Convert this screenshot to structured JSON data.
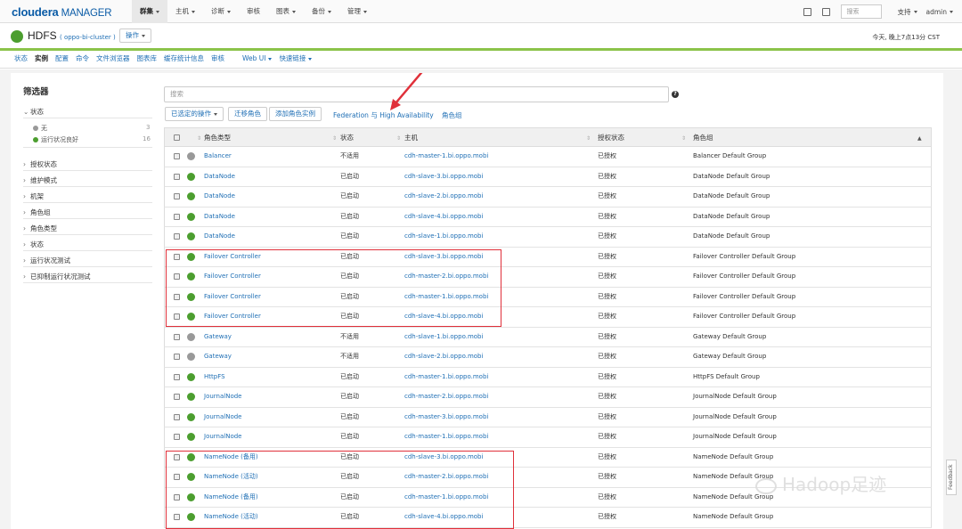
{
  "topbar": {
    "logo_brand": "cloudera",
    "logo_product": "MANAGER",
    "nav": [
      {
        "label": "群集",
        "active": true,
        "dropdown": true
      },
      {
        "label": "主机",
        "active": false,
        "dropdown": true
      },
      {
        "label": "诊断",
        "active": false,
        "dropdown": true
      },
      {
        "label": "审核",
        "active": false,
        "dropdown": false
      },
      {
        "label": "图表",
        "active": false,
        "dropdown": true
      },
      {
        "label": "备份",
        "active": false,
        "dropdown": true
      },
      {
        "label": "管理",
        "active": false,
        "dropdown": true
      }
    ],
    "search_placeholder": "搜索",
    "support_label": "支持",
    "user_label": "admin"
  },
  "service_header": {
    "title": "HDFS",
    "cluster": "( oppo-bi-cluster )",
    "actions_label": "操作",
    "time": "今天, 晚上7点13分 CST",
    "status_color": "#4c9e2f"
  },
  "subnav": [
    {
      "label": "状态",
      "active": false
    },
    {
      "label": "实例",
      "active": true
    },
    {
      "label": "配置",
      "active": false
    },
    {
      "label": "命令",
      "active": false
    },
    {
      "label": "文件浏览器",
      "active": false
    },
    {
      "label": "图表库",
      "active": false
    },
    {
      "label": "缓存统计信息",
      "active": false
    },
    {
      "label": "审核",
      "active": false
    },
    {
      "label": "Web UI",
      "active": false,
      "dropdown": true
    },
    {
      "label": "快速链接",
      "active": false,
      "dropdown": true
    }
  ],
  "filters": {
    "title": "筛选器",
    "status_section": "状态",
    "status_items": [
      {
        "label": "无",
        "count": "3",
        "color": "#999999"
      },
      {
        "label": "运行状况良好",
        "count": "16",
        "color": "#4c9e2f"
      }
    ],
    "sections": [
      "授权状态",
      "维护模式",
      "机架",
      "角色组",
      "角色类型",
      "状态",
      "运行状况测试",
      "已抑制运行状况测试"
    ]
  },
  "toolbar": {
    "search_placeholder": "搜索",
    "selected_actions": "已选定的操作",
    "migrate_roles": "迁移角色",
    "add_role_instances": "添加角色实例",
    "federation_ha": "Federation 与 High Availability",
    "role_groups": "角色组"
  },
  "table": {
    "headers": [
      "角色类型",
      "状态",
      "主机",
      "授权状态",
      "角色组"
    ],
    "rows": [
      {
        "role": "Balancer",
        "state": "不适用",
        "host": "cdh-master-1.bi.oppo.mobi",
        "auth": "已授权",
        "group": "Balancer Default Group",
        "health": "#999999"
      },
      {
        "role": "DataNode",
        "state": "已启动",
        "host": "cdh-slave-3.bi.oppo.mobi",
        "auth": "已授权",
        "group": "DataNode Default Group",
        "health": "#4c9e2f"
      },
      {
        "role": "DataNode",
        "state": "已启动",
        "host": "cdh-slave-2.bi.oppo.mobi",
        "auth": "已授权",
        "group": "DataNode Default Group",
        "health": "#4c9e2f"
      },
      {
        "role": "DataNode",
        "state": "已启动",
        "host": "cdh-slave-4.bi.oppo.mobi",
        "auth": "已授权",
        "group": "DataNode Default Group",
        "health": "#4c9e2f"
      },
      {
        "role": "DataNode",
        "state": "已启动",
        "host": "cdh-slave-1.bi.oppo.mobi",
        "auth": "已授权",
        "group": "DataNode Default Group",
        "health": "#4c9e2f"
      },
      {
        "role": "Failover Controller",
        "state": "已启动",
        "host": "cdh-slave-3.bi.oppo.mobi",
        "auth": "已授权",
        "group": "Failover Controller Default Group",
        "health": "#4c9e2f"
      },
      {
        "role": "Failover Controller",
        "state": "已启动",
        "host": "cdh-master-2.bi.oppo.mobi",
        "auth": "已授权",
        "group": "Failover Controller Default Group",
        "health": "#4c9e2f"
      },
      {
        "role": "Failover Controller",
        "state": "已启动",
        "host": "cdh-master-1.bi.oppo.mobi",
        "auth": "已授权",
        "group": "Failover Controller Default Group",
        "health": "#4c9e2f"
      },
      {
        "role": "Failover Controller",
        "state": "已启动",
        "host": "cdh-slave-4.bi.oppo.mobi",
        "auth": "已授权",
        "group": "Failover Controller Default Group",
        "health": "#4c9e2f"
      },
      {
        "role": "Gateway",
        "state": "不适用",
        "host": "cdh-slave-1.bi.oppo.mobi",
        "auth": "已授权",
        "group": "Gateway Default Group",
        "health": "#999999"
      },
      {
        "role": "Gateway",
        "state": "不适用",
        "host": "cdh-slave-2.bi.oppo.mobi",
        "auth": "已授权",
        "group": "Gateway Default Group",
        "health": "#999999"
      },
      {
        "role": "HttpFS",
        "state": "已启动",
        "host": "cdh-master-1.bi.oppo.mobi",
        "auth": "已授权",
        "group": "HttpFS Default Group",
        "health": "#4c9e2f"
      },
      {
        "role": "JournalNode",
        "state": "已启动",
        "host": "cdh-master-2.bi.oppo.mobi",
        "auth": "已授权",
        "group": "JournalNode Default Group",
        "health": "#4c9e2f"
      },
      {
        "role": "JournalNode",
        "state": "已启动",
        "host": "cdh-master-3.bi.oppo.mobi",
        "auth": "已授权",
        "group": "JournalNode Default Group",
        "health": "#4c9e2f"
      },
      {
        "role": "JournalNode",
        "state": "已启动",
        "host": "cdh-master-1.bi.oppo.mobi",
        "auth": "已授权",
        "group": "JournalNode Default Group",
        "health": "#4c9e2f"
      },
      {
        "role": "NameNode (备用)",
        "state": "已启动",
        "host": "cdh-slave-3.bi.oppo.mobi",
        "auth": "已授权",
        "group": "NameNode Default Group",
        "health": "#4c9e2f"
      },
      {
        "role": "NameNode (活动)",
        "state": "已启动",
        "host": "cdh-master-2.bi.oppo.mobi",
        "auth": "已授权",
        "group": "NameNode Default Group",
        "health": "#4c9e2f"
      },
      {
        "role": "NameNode (备用)",
        "state": "已启动",
        "host": "cdh-master-1.bi.oppo.mobi",
        "auth": "已授权",
        "group": "NameNode Default Group",
        "health": "#4c9e2f"
      },
      {
        "role": "NameNode (活动)",
        "state": "已启动",
        "host": "cdh-slave-4.bi.oppo.mobi",
        "auth": "已授权",
        "group": "NameNode Default Group",
        "health": "#4c9e2f"
      }
    ]
  },
  "watermark": "Hadoop足迹",
  "feedback_label": "Feedback",
  "accent_color": "#1f6fb5",
  "highlight_color": "#e0303a"
}
